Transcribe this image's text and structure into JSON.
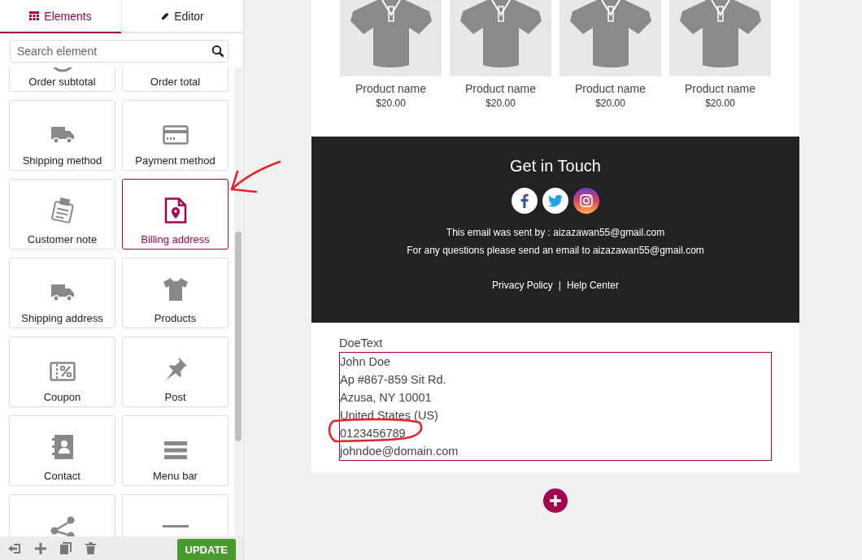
{
  "tabs": [
    {
      "label": "Elements",
      "selected": true
    },
    {
      "label": "Editor",
      "selected": false
    }
  ],
  "search": {
    "placeholder": "Search element"
  },
  "elements": [
    {
      "label": "Order subtotal",
      "selected": false
    },
    {
      "label": "Order total",
      "selected": false
    },
    {
      "label": "Shipping method",
      "selected": false
    },
    {
      "label": "Payment method",
      "selected": false
    },
    {
      "label": "Customer note",
      "selected": false
    },
    {
      "label": "Billing address",
      "selected": true
    },
    {
      "label": "Shipping address",
      "selected": false
    },
    {
      "label": "Products",
      "selected": false
    },
    {
      "label": "Coupon",
      "selected": false
    },
    {
      "label": "Post",
      "selected": false
    },
    {
      "label": "Contact",
      "selected": false
    },
    {
      "label": "Menu bar",
      "selected": false
    },
    {
      "selected": false
    },
    {
      "selected": false
    }
  ],
  "update_button": "UPDATE",
  "products": [
    {
      "name": "Product name",
      "price": "$20.00"
    },
    {
      "name": "Product name",
      "price": "$20.00"
    },
    {
      "name": "Product name",
      "price": "$20.00"
    },
    {
      "name": "Product name",
      "price": "$20.00"
    }
  ],
  "footer": {
    "title": "Get in Touch",
    "lines": [
      "This email was sent by : aizazawan55@gmail.com",
      "For any questions please send an email to aizazawan55@gmail.com"
    ],
    "links": [
      "Privacy Policy",
      "Help Center"
    ],
    "separator": "|"
  },
  "address": {
    "heading": "DoeText",
    "lines": [
      "John Doe",
      "Ap #867-859 Sit Rd.",
      "Azusa, NY 10001",
      "United States (US)",
      "0123456789",
      "johndoe@domain.com"
    ]
  },
  "annotations": [
    {
      "kind": "arrow"
    },
    {
      "kind": "circle"
    }
  ]
}
